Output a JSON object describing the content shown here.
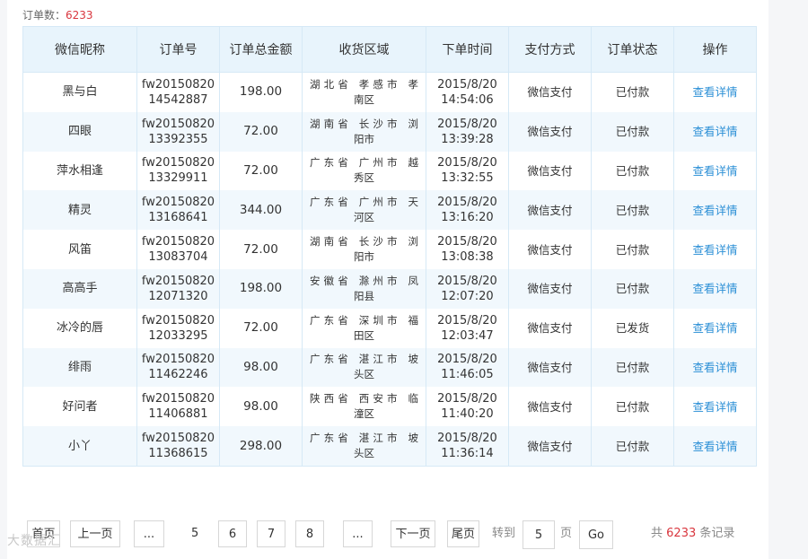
{
  "header": {
    "count_label": "订单数：",
    "count_value": "6233"
  },
  "table": {
    "columns": [
      "微信昵称",
      "订单号",
      "订单总金额",
      "收货区域",
      "下单时间",
      "支付方式",
      "订单状态",
      "操作"
    ],
    "rows": [
      {
        "nick": "黑与白",
        "id1": "fw20150820",
        "id2": "14542887",
        "amount": "198.00",
        "region1": "湖北省 孝感市 孝",
        "region2": "南区",
        "date": "2015/8/20",
        "time": "14:54:06",
        "pay": "微信支付",
        "status": "已付款",
        "op": "查看详情"
      },
      {
        "nick": "四眼",
        "id1": "fw20150820",
        "id2": "13392355",
        "amount": "72.00",
        "region1": "湖南省 长沙市 浏",
        "region2": "阳市",
        "date": "2015/8/20",
        "time": "13:39:28",
        "pay": "微信支付",
        "status": "已付款",
        "op": "查看详情"
      },
      {
        "nick": "萍水相逢",
        "id1": "fw20150820",
        "id2": "13329911",
        "amount": "72.00",
        "region1": "广东省 广州市 越",
        "region2": "秀区",
        "date": "2015/8/20",
        "time": "13:32:55",
        "pay": "微信支付",
        "status": "已付款",
        "op": "查看详情"
      },
      {
        "nick": "精灵",
        "id1": "fw20150820",
        "id2": "13168641",
        "amount": "344.00",
        "region1": "广东省 广州市 天",
        "region2": "河区",
        "date": "2015/8/20",
        "time": "13:16:20",
        "pay": "微信支付",
        "status": "已付款",
        "op": "查看详情"
      },
      {
        "nick": "风笛",
        "id1": "fw20150820",
        "id2": "13083704",
        "amount": "72.00",
        "region1": "湖南省 长沙市 浏",
        "region2": "阳市",
        "date": "2015/8/20",
        "time": "13:08:38",
        "pay": "微信支付",
        "status": "已付款",
        "op": "查看详情"
      },
      {
        "nick": "高高手",
        "id1": "fw20150820",
        "id2": "12071320",
        "amount": "198.00",
        "region1": "安徽省 滁州市 凤",
        "region2": "阳县",
        "date": "2015/8/20",
        "time": "12:07:20",
        "pay": "微信支付",
        "status": "已付款",
        "op": "查看详情"
      },
      {
        "nick": "冰冷的唇",
        "id1": "fw20150820",
        "id2": "12033295",
        "amount": "72.00",
        "region1": "广东省 深圳市 福",
        "region2": "田区",
        "date": "2015/8/20",
        "time": "12:03:47",
        "pay": "微信支付",
        "status": "已发货",
        "op": "查看详情"
      },
      {
        "nick": "绯雨",
        "id1": "fw20150820",
        "id2": "11462246",
        "amount": "98.00",
        "region1": "广东省 湛江市 坡",
        "region2": "头区",
        "date": "2015/8/20",
        "time": "11:46:05",
        "pay": "微信支付",
        "status": "已付款",
        "op": "查看详情"
      },
      {
        "nick": "好问者",
        "id1": "fw20150820",
        "id2": "11406881",
        "amount": "98.00",
        "region1": "陕西省 西安市 临",
        "region2": "潼区",
        "date": "2015/8/20",
        "time": "11:40:20",
        "pay": "微信支付",
        "status": "已付款",
        "op": "查看详情"
      },
      {
        "nick": "小丫",
        "id1": "fw20150820",
        "id2": "11368615",
        "amount": "298.00",
        "region1": "广东省 湛江市 坡",
        "region2": "头区",
        "date": "2015/8/20",
        "time": "11:36:14",
        "pay": "微信支付",
        "status": "已付款",
        "op": "查看详情"
      }
    ]
  },
  "pager": {
    "first": "首页",
    "prev": "上一页",
    "ellipsis_left": "...",
    "current": "5",
    "p6": "6",
    "p7": "7",
    "p8": "8",
    "ellipsis_right": "...",
    "next": "下一页",
    "last": "尾页",
    "goto_label": "转到",
    "goto_value": "5",
    "page_label": "页",
    "go": "Go",
    "total_prefix": "共",
    "total_value": "6233",
    "total_suffix": "条记录"
  },
  "watermark": "大数据汇"
}
